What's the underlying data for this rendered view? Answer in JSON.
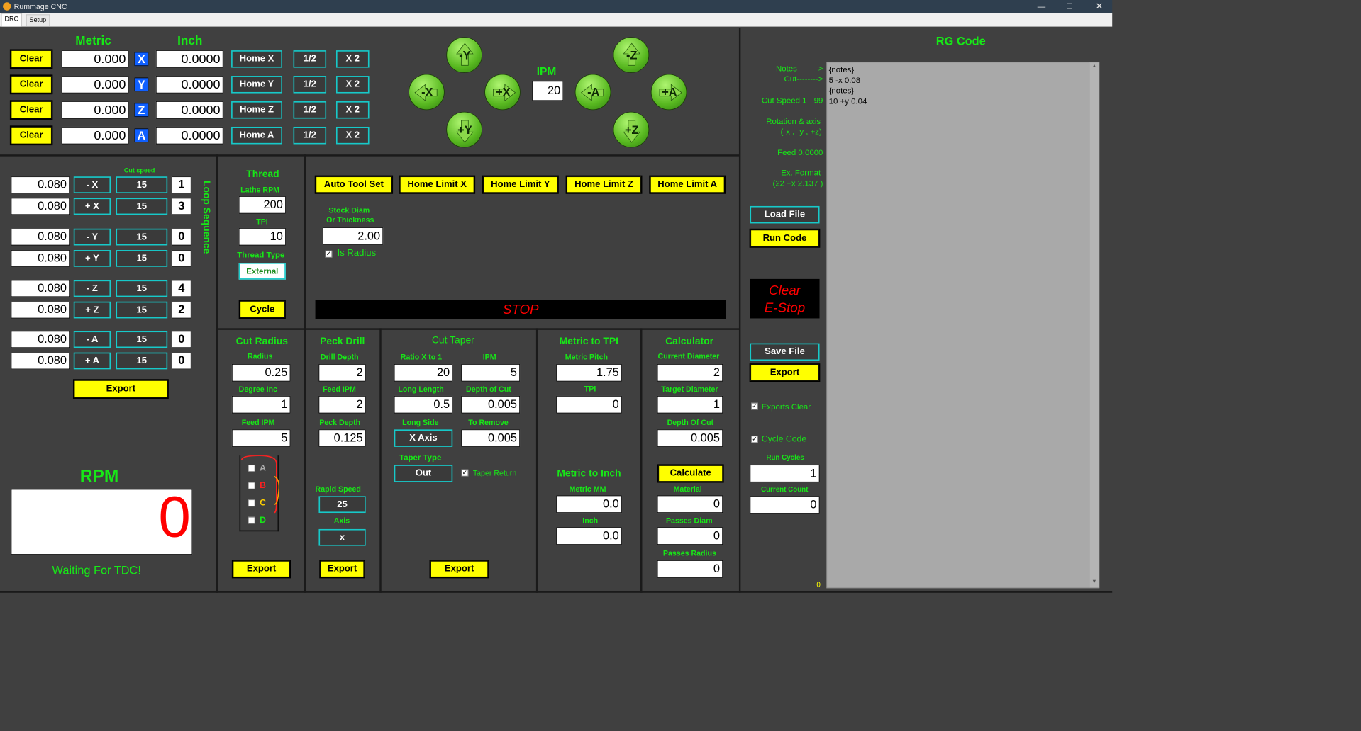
{
  "window": {
    "title": "Rummage CNC"
  },
  "tabs": [
    "DRO",
    "Setup"
  ],
  "dro": {
    "metric_label": "Metric",
    "inch_label": "Inch",
    "rows": [
      {
        "clear": "Clear",
        "metric": "0.000",
        "axis": "X",
        "inch": "0.0000",
        "home": "Home X",
        "half": "1/2",
        "x2": "X 2"
      },
      {
        "clear": "Clear",
        "metric": "0.000",
        "axis": "Y",
        "inch": "0.0000",
        "home": "Home Y",
        "half": "1/2",
        "x2": "X 2"
      },
      {
        "clear": "Clear",
        "metric": "0.000",
        "axis": "Z",
        "inch": "0.0000",
        "home": "Home Z",
        "half": "1/2",
        "x2": "X 2"
      },
      {
        "clear": "Clear",
        "metric": "0.000",
        "axis": "A",
        "inch": "0.0000",
        "home": "Home A",
        "half": "1/2",
        "x2": "X 2"
      }
    ]
  },
  "jog": {
    "ipm_label": "IPM",
    "ipm": "20",
    "minus_y": "-Y",
    "plus_y": "+Y",
    "minus_x": "-X",
    "plus_x": "+X",
    "minus_z": "-Z",
    "plus_z": "+Z",
    "minus_a": "-A",
    "plus_a": "+A"
  },
  "loop": {
    "cut_speed_label": "Cut speed",
    "sequence_label": "Loop Sequence",
    "rows": [
      {
        "dist": "0.080",
        "dir": "- X",
        "speed": "15",
        "seq": "1"
      },
      {
        "dist": "0.080",
        "dir": "+ X",
        "speed": "15",
        "seq": "3"
      },
      {
        "dist": "0.080",
        "dir": "- Y",
        "speed": "15",
        "seq": "0"
      },
      {
        "dist": "0.080",
        "dir": "+ Y",
        "speed": "15",
        "seq": "0"
      },
      {
        "dist": "0.080",
        "dir": "- Z",
        "speed": "15",
        "seq": "4"
      },
      {
        "dist": "0.080",
        "dir": "+ Z",
        "speed": "15",
        "seq": "2"
      },
      {
        "dist": "0.080",
        "dir": "- A",
        "speed": "15",
        "seq": "0"
      },
      {
        "dist": "0.080",
        "dir": "+ A",
        "speed": "15",
        "seq": "0"
      }
    ],
    "export": "Export"
  },
  "rpm": {
    "label": "RPM",
    "value": "0",
    "status": "Waiting For TDC!"
  },
  "thread": {
    "title": "Thread",
    "lathe_rpm_label": "Lathe RPM",
    "lathe_rpm": "200",
    "tpi_label": "TPI",
    "tpi": "10",
    "type_label": "Thread Type",
    "type": "External",
    "cycle": "Cycle"
  },
  "tools": {
    "auto_tool_set": "Auto Tool Set",
    "home_limit_x": "Home Limit X",
    "home_limit_y": "Home Limit Y",
    "home_limit_z": "Home Limit Z",
    "home_limit_a": "Home Limit A",
    "stock_label_1": "Stock Diam",
    "stock_label_2": "Or Thickness",
    "stock": "2.00",
    "is_radius": "Is Radius",
    "stop": "STOP"
  },
  "cut_radius": {
    "title": "Cut Radius",
    "radius_label": "Radius",
    "radius": "0.25",
    "degree_label": "Degree Inc",
    "degree": "1",
    "feed_label": "Feed IPM",
    "feed": "5",
    "quads": [
      "A",
      "B",
      "C",
      "D"
    ],
    "export": "Export"
  },
  "peck": {
    "title": "Peck Drill",
    "depth_label": "Drill Depth",
    "depth": "2",
    "feed_label": "Feed IPM",
    "feed": "2",
    "peck_label": "Peck Depth",
    "peck": "0.125",
    "rapid_label": "Rapid Speed",
    "rapid": "25",
    "axis_label": "Axis",
    "axis": "x",
    "export": "Export"
  },
  "taper": {
    "title": "Cut Taper",
    "ratio_label": "Ratio X to 1",
    "ratio": "20",
    "ipm_label": "IPM",
    "ipm": "5",
    "long_label": "Long Length",
    "long": "0.5",
    "depth_label": "Depth of Cut",
    "depth": "0.005",
    "side_label": "Long Side",
    "side": "X Axis",
    "remove_label": "To Remove",
    "remove": "0.005",
    "type_label": "Taper Type",
    "type": "Out",
    "return_label": "Taper Return",
    "export": "Export"
  },
  "metric_tpi": {
    "title": "Metric to TPI",
    "pitch_label": "Metric Pitch",
    "pitch": "1.75",
    "tpi_label": "TPI",
    "tpi": "0",
    "inch_title": "Metric to Inch",
    "mm_label": "Metric MM",
    "mm": "0.0",
    "inch_label": "Inch",
    "inch": "0.0"
  },
  "calc": {
    "title": "Calculator",
    "cur_label": "Current Diameter",
    "cur": "2",
    "target_label": "Target Diameter",
    "target": "1",
    "doc_label": "Depth Of Cut",
    "doc": "0.005",
    "calculate": "Calculate",
    "mat_label": "Material",
    "mat": "0",
    "pd_label": "Passes Diam",
    "pd": "0",
    "pr_label": "Passes Radius",
    "pr": "0"
  },
  "rg": {
    "title": "RG Code",
    "notes": "Notes ------->",
    "cut": "Cut-------->",
    "cut_speed": "Cut Speed 1 - 99",
    "rot1": "Rotation & axis",
    "rot2": "(-x , -y , +z)",
    "feed": "Feed  0.0000",
    "ex1": "Ex. Format",
    "ex2": "(22 +x 2.137 )",
    "load": "Load File",
    "run": "Run Code",
    "clear_estop_1": "Clear",
    "clear_estop_2": "E-Stop",
    "save": "Save File",
    "export": "Export",
    "exports_clear": "Exports Clear",
    "cycle_code": "Cycle Code",
    "run_cycles_label": "Run Cycles",
    "run_cycles": "1",
    "current_count_label": "Current Count",
    "current_count": "0",
    "line_no": "0",
    "code": [
      "{notes}",
      "5 -x 0.08",
      "{notes}",
      "10 +y 0.04"
    ]
  }
}
